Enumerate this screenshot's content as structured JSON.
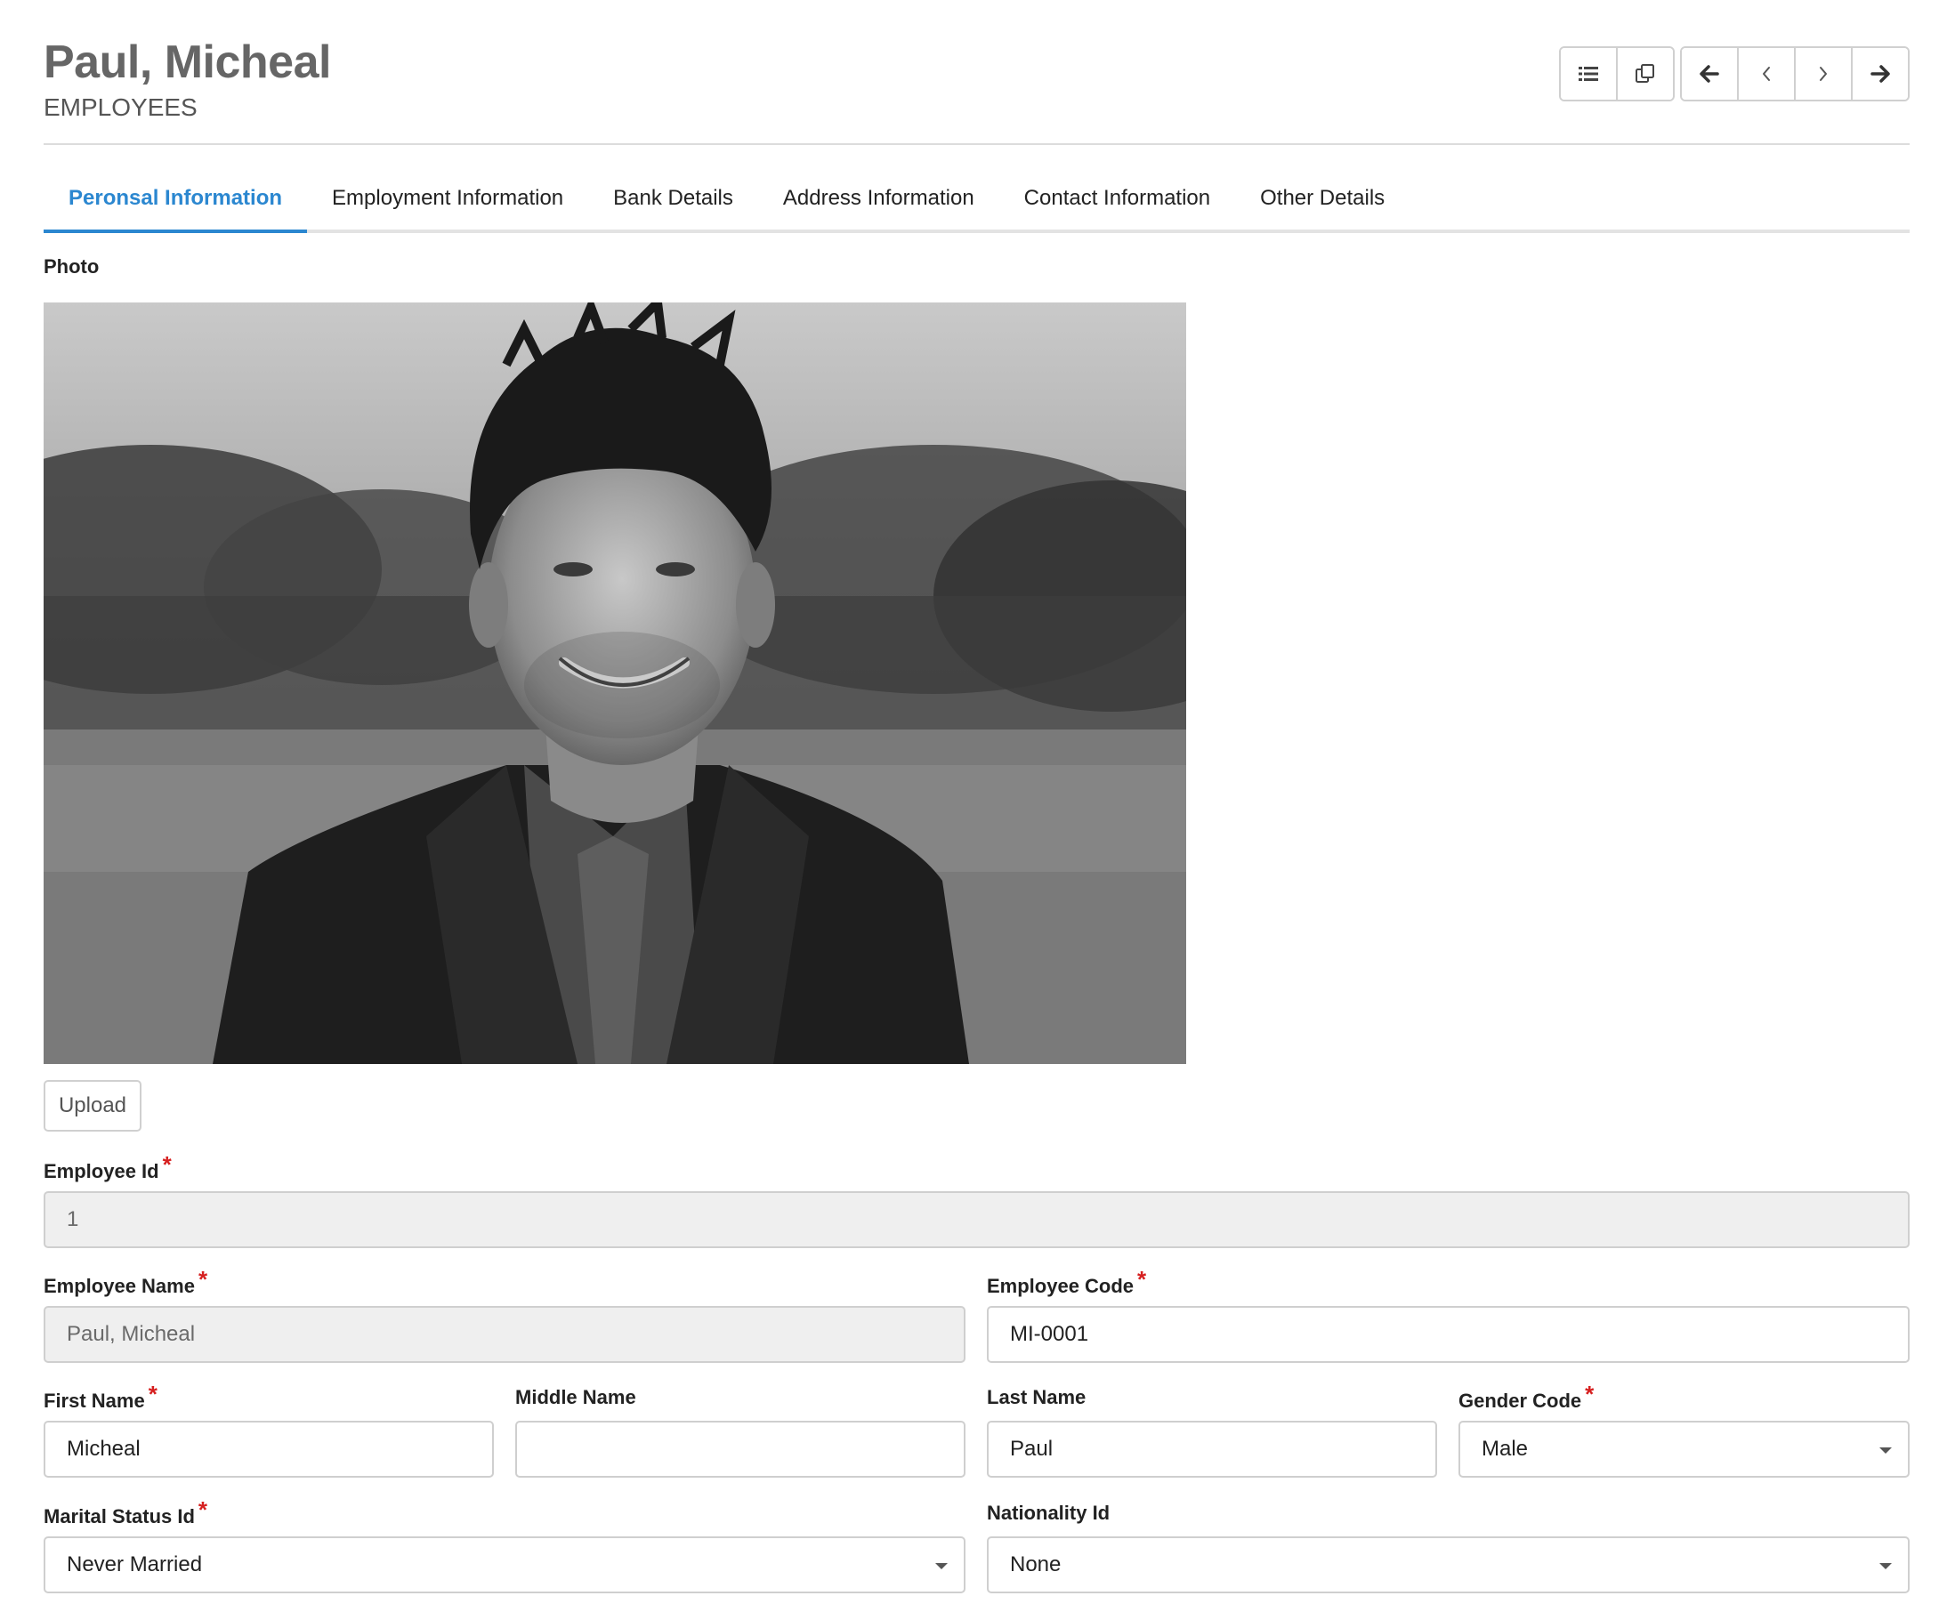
{
  "header": {
    "title": "Paul, Micheal",
    "subtitle": "EMPLOYEES"
  },
  "toolbar": {
    "icons": [
      "list-icon",
      "copy-icon",
      "arrow-left-icon",
      "chevron-left-icon",
      "chevron-right-icon",
      "arrow-right-icon"
    ]
  },
  "tabs": [
    {
      "label": "Peronsal Information",
      "active": true
    },
    {
      "label": "Employment Information"
    },
    {
      "label": "Bank Details"
    },
    {
      "label": "Address Information"
    },
    {
      "label": "Contact Information"
    },
    {
      "label": "Other Details"
    }
  ],
  "photo": {
    "label": "Photo",
    "upload_label": "Upload"
  },
  "fields": {
    "employee_id": {
      "label": "Employee Id",
      "value": "1"
    },
    "employee_name": {
      "label": "Employee Name",
      "value": "Paul, Micheal"
    },
    "employee_code": {
      "label": "Employee Code",
      "value": "MI-0001"
    },
    "first_name": {
      "label": "First Name",
      "value": "Micheal"
    },
    "middle_name": {
      "label": "Middle Name",
      "value": ""
    },
    "last_name": {
      "label": "Last Name",
      "value": "Paul"
    },
    "gender_code": {
      "label": "Gender Code",
      "value": "Male"
    },
    "marital_status": {
      "label": "Marital Status Id",
      "value": "Never Married"
    },
    "nationality": {
      "label": "Nationality Id",
      "value": "None"
    }
  },
  "required_marker": "*",
  "colors": {
    "accent": "#2b87d0",
    "required": "#d61f1f",
    "title": "#666666"
  }
}
